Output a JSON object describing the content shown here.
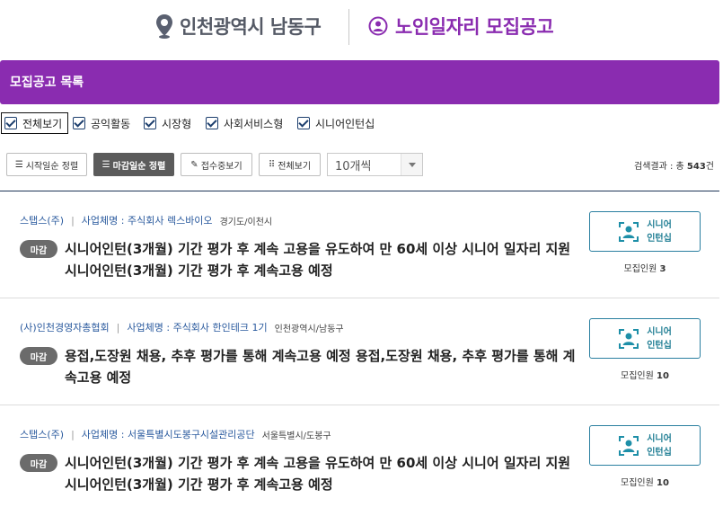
{
  "header": {
    "region": "인천광역시 남동구",
    "title": "노인일자리 모집공고"
  },
  "section_title": "모집공고 목록",
  "filters": [
    {
      "label": "전체보기",
      "checked": true
    },
    {
      "label": "공익활동",
      "checked": true
    },
    {
      "label": "시장형",
      "checked": true
    },
    {
      "label": "사회서비스형",
      "checked": true
    },
    {
      "label": "시니어인턴십",
      "checked": true
    }
  ],
  "toolbar": {
    "sort_start": "시작일순 정렬",
    "sort_end": "마감일순 정렬",
    "show_open": "접수중보기",
    "show_all": "전체보기",
    "page_size": "10개씩",
    "result_label": "검색결과 : 총 ",
    "result_count": "543",
    "result_unit": "건"
  },
  "items": [
    {
      "org": "스탭스(주)",
      "company": "사업체명 : 주식회사 렉스바이오",
      "location": "경기도/이천시",
      "status": "마감",
      "title": "시니어인턴(3개월) 기간 평가 후 계속 고용을 유도하여 만 60세 이상 시니어 일자리 지원 시니어인턴(3개월) 기간 평가 후 계속고용 예정",
      "category_line1": "시니어",
      "category_line2": "인턴십",
      "recruit_label": "모집인원",
      "recruit_count": "3"
    },
    {
      "org": "(사)인천경영자총협회",
      "company": "사업체명 : 주식회사 한인테크 1기",
      "location": "인천광역시/남동구",
      "status": "마감",
      "title": "용접,도장원 채용, 추후 평가를 통해 계속고용 예정 용접,도장원 채용, 추후 평가를 통해 계속고용 예정",
      "category_line1": "시니어",
      "category_line2": "인턴십",
      "recruit_label": "모집인원",
      "recruit_count": "10"
    },
    {
      "org": "스탭스(주)",
      "company": "사업체명 : 서울특별시도봉구시설관리공단",
      "location": "서울특별시/도봉구",
      "status": "마감",
      "title": "시니어인턴(3개월) 기간 평가 후 계속 고용을 유도하여 만 60세 이상 시니어 일자리 지원 시니어인턴(3개월) 기간 평가 후 계속고용 예정",
      "category_line1": "시니어",
      "category_line2": "인턴십",
      "recruit_label": "모집인원",
      "recruit_count": "10"
    }
  ],
  "colors": {
    "brand_purple": "#8a2cb0",
    "accent_teal": "#1e7d93",
    "link_blue": "#2a5a9e"
  }
}
